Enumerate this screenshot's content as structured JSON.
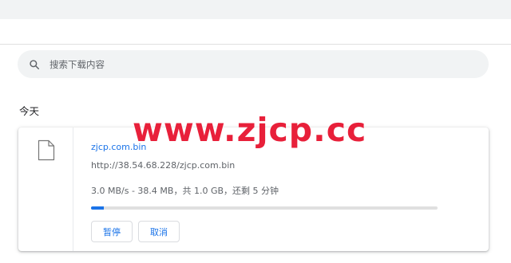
{
  "search": {
    "placeholder": "搜索下载内容",
    "icon": "search-icon"
  },
  "section": {
    "label": "今天"
  },
  "download": {
    "file_name": "zjcp.com.bin",
    "url": "http://38.54.68.228/zjcp.com.bin",
    "status": "3.0 MB/s - 38.4 MB，共 1.0 GB，还剩 5 分钟",
    "progress_fraction": 0.0375,
    "file_icon": "file-icon",
    "pause_label": "暂停",
    "cancel_label": "取消"
  },
  "watermark": {
    "text": "www.zjcp.cc"
  },
  "colors": {
    "accent": "#1a73e8",
    "watermark": "#e8203a",
    "search_bg": "#f1f3f4"
  }
}
